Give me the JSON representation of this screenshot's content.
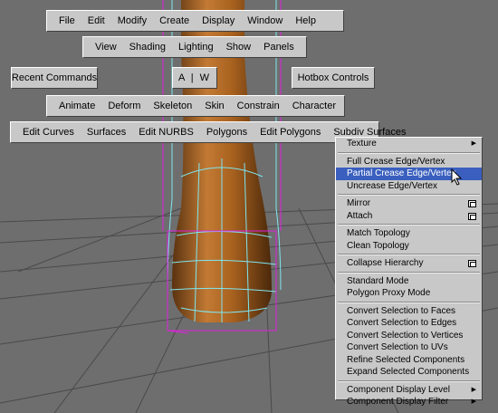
{
  "menus": {
    "main": [
      "File",
      "Edit",
      "Modify",
      "Create",
      "Display",
      "Window",
      "Help"
    ],
    "view": [
      "View",
      "Shading",
      "Lighting",
      "Show",
      "Panels"
    ],
    "recent_commands": "Recent Commands",
    "aw": "A | W",
    "hotbox_controls": "Hotbox Controls",
    "animation": [
      "Animate",
      "Deform",
      "Skeleton",
      "Skin",
      "Constrain",
      "Character"
    ],
    "modeling": [
      "Edit Curves",
      "Surfaces",
      "Edit NURBS",
      "Polygons",
      "Edit Polygons",
      "Subdiv Surfaces"
    ]
  },
  "context_menu": {
    "items": [
      {
        "label": "Texture",
        "submenu": true
      },
      {
        "sep": true
      },
      {
        "label": "Full Crease Edge/Vertex"
      },
      {
        "label": "Partial Crease Edge/Vertex",
        "highlighted": true
      },
      {
        "label": "Uncrease Edge/Vertex"
      },
      {
        "sep": true
      },
      {
        "label": "Mirror",
        "option_box": true
      },
      {
        "label": "Attach",
        "option_box": true
      },
      {
        "sep": true
      },
      {
        "label": "Match Topology"
      },
      {
        "label": "Clean Topology"
      },
      {
        "sep": true
      },
      {
        "label": "Collapse Hierarchy",
        "option_box": true
      },
      {
        "sep": true
      },
      {
        "label": "Standard Mode"
      },
      {
        "label": "Polygon Proxy Mode"
      },
      {
        "sep": true
      },
      {
        "label": "Convert Selection to Faces"
      },
      {
        "label": "Convert Selection to Edges"
      },
      {
        "label": "Convert Selection to Vertices"
      },
      {
        "label": "Convert Selection to UVs"
      },
      {
        "label": "Refine Selected Components"
      },
      {
        "label": "Expand Selected Components"
      },
      {
        "sep": true
      },
      {
        "label": "Component Display Level",
        "submenu": true
      },
      {
        "label": "Component Display Filter",
        "submenu": true
      }
    ]
  },
  "colors": {
    "viewport_bg": "#6e6e6e",
    "menu_bg": "#c8c8c8",
    "highlight": "#3a5fbe",
    "wire_cyan": "#7fe6f0",
    "wire_magenta": "#e020e0",
    "object_brown": "#9a5a20"
  }
}
